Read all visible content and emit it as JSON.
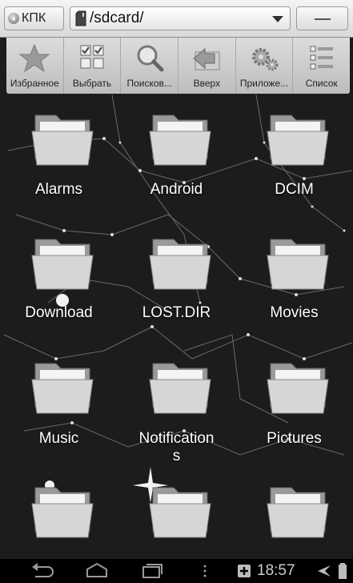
{
  "topbar": {
    "kpk_label": "КПК",
    "path": "/sdcard/"
  },
  "toolbar": [
    {
      "label": "Избранное",
      "icon": "star-icon"
    },
    {
      "label": "Выбрать",
      "icon": "checklist-icon"
    },
    {
      "label": "Поисков...",
      "icon": "search-icon"
    },
    {
      "label": "Вверх",
      "icon": "folder-up-icon"
    },
    {
      "label": "Приложе...",
      "icon": "gears-icon"
    },
    {
      "label": "Список",
      "icon": "list-view-icon"
    }
  ],
  "folders": [
    {
      "name": "Alarms"
    },
    {
      "name": "Android"
    },
    {
      "name": "DCIM"
    },
    {
      "name": "Download"
    },
    {
      "name": "LOST.DIR"
    },
    {
      "name": "Movies"
    },
    {
      "name": "Music"
    },
    {
      "name": "Notification\ns"
    },
    {
      "name": "Pictures"
    },
    {
      "name": ""
    },
    {
      "name": ""
    },
    {
      "name": ""
    }
  ],
  "statusbar": {
    "time": "18:57"
  },
  "colors": {
    "background": "#1c1c1c",
    "toolbar": "#c8c8c8",
    "navbar": "#000000"
  }
}
